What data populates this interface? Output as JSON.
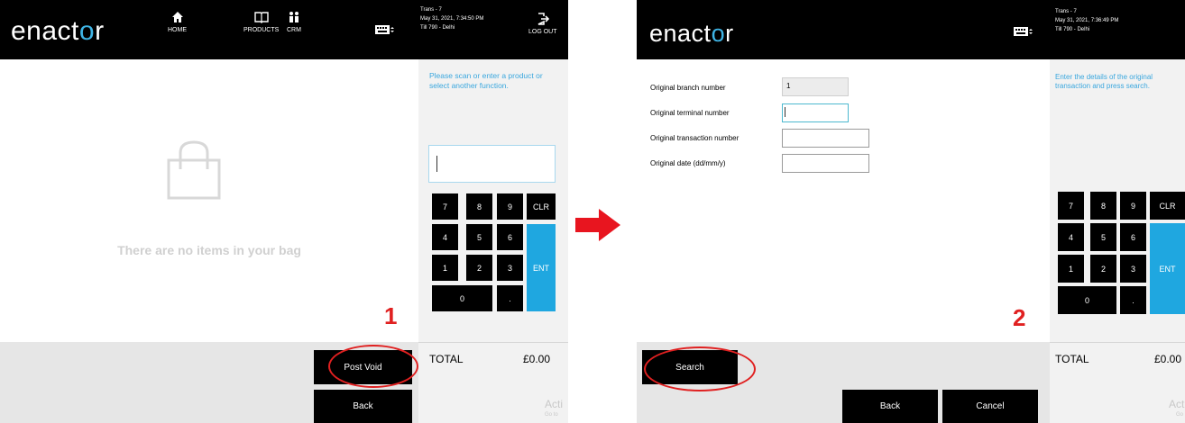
{
  "colors": {
    "accent": "#1fa7e0",
    "prompt": "#3aa7de",
    "annotation": "#e02020",
    "header": "#000000"
  },
  "screen1": {
    "logo_pre": "enact",
    "logo_o": "o",
    "logo_post": "r",
    "nav": {
      "home": "HOME",
      "products": "PRODUCTS",
      "crm": "CRM"
    },
    "trans": "Trans - 7",
    "datetime": "May 31, 2021, 7:34:50 PM",
    "till": "Till 790 - Delhi",
    "logout": "LOG OUT",
    "empty_bag": "There are no items in your bag",
    "prompt": "Please scan or enter a product or select another function.",
    "keys": [
      "7",
      "8",
      "9",
      "CLR",
      "4",
      "5",
      "6",
      "ENT",
      "1",
      "2",
      "3",
      "0",
      "."
    ],
    "total_label": "TOTAL",
    "total_value": "£0.00",
    "post_void": "Post Void",
    "back": "Back",
    "step": "1",
    "watermark": "Acti",
    "watermark_sub": "Go to"
  },
  "screen2": {
    "logo_pre": "enact",
    "logo_o": "o",
    "logo_post": "r",
    "trans": "Trans - 7",
    "datetime": "May 31, 2021, 7:36:49 PM",
    "till": "Till 790 - Delhi",
    "prompt": "Enter the details of the original transaction and press search.",
    "fields": {
      "branch_label": "Original branch number",
      "branch_value": "1",
      "terminal_label": "Original terminal number",
      "terminal_value": "",
      "transaction_label": "Original transaction number",
      "transaction_value": "",
      "date_label": "Original date (dd/mm/y)",
      "date_value": ""
    },
    "keys": [
      "7",
      "8",
      "9",
      "CLR",
      "4",
      "5",
      "6",
      "ENT",
      "1",
      "2",
      "3",
      "0",
      "."
    ],
    "total_label": "TOTAL",
    "total_value": "£0.00",
    "search": "Search",
    "back": "Back",
    "cancel": "Cancel",
    "step": "2",
    "watermark": "Acti",
    "watermark_sub": "Go"
  }
}
